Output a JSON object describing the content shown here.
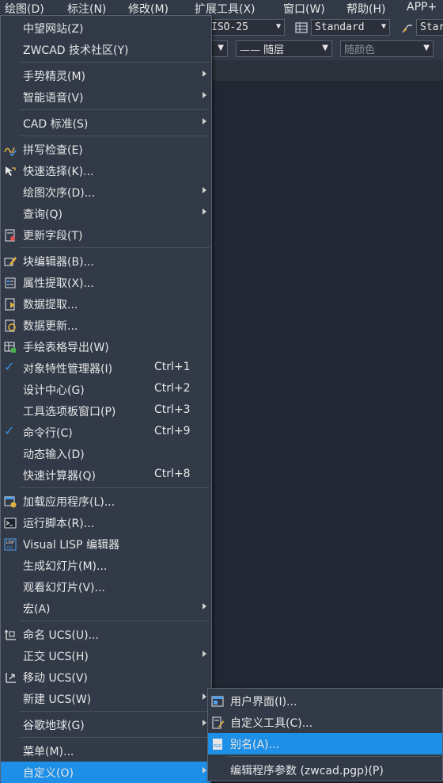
{
  "menubar": {
    "items": [
      "绘图(D)",
      "标注(N)",
      "修改(M)",
      "扩展工具(X)",
      "窗口(W)",
      "帮助(H)",
      "APP+"
    ]
  },
  "toolbar": {
    "dimstyle": "ISO-25",
    "tablestyle": "Standard",
    "mleaderstyle": "Star",
    "linetype": "—— 随层",
    "color": "随颜色"
  },
  "menu": {
    "items": [
      {
        "label": "中望网站(Z)",
        "icon": "",
        "submenu": false
      },
      {
        "label": "ZWCAD 技术社区(Y)",
        "icon": "",
        "submenu": false
      },
      {
        "label": "手势精灵(M)",
        "icon": "",
        "submenu": true
      },
      {
        "label": "智能语音(V)",
        "icon": "",
        "submenu": true
      },
      {
        "label": "CAD 标准(S)",
        "icon": "",
        "submenu": true
      },
      {
        "label": "拼写检查(E)",
        "icon": "spell-check-icon",
        "submenu": false
      },
      {
        "label": "快速选择(K)...",
        "icon": "quick-select-icon",
        "submenu": false
      },
      {
        "label": "绘图次序(D)...",
        "icon": "",
        "submenu": true
      },
      {
        "label": "查询(Q)",
        "icon": "",
        "submenu": true
      },
      {
        "label": "更新字段(T)",
        "icon": "update-field-icon",
        "submenu": false
      },
      {
        "label": "块编辑器(B)...",
        "icon": "block-editor-icon",
        "submenu": false
      },
      {
        "label": "属性提取(X)...",
        "icon": "attribute-extract-icon",
        "submenu": false
      },
      {
        "label": "数据提取...",
        "icon": "data-extract-icon",
        "submenu": false
      },
      {
        "label": "数据更新...",
        "icon": "data-update-icon",
        "submenu": false
      },
      {
        "label": "手绘表格导出(W)",
        "icon": "table-export-icon",
        "submenu": false
      },
      {
        "label": "对象特性管理器(I)",
        "icon": "check-icon",
        "shortcut": "Ctrl+1",
        "submenu": false
      },
      {
        "label": "设计中心(G)",
        "icon": "",
        "shortcut": "Ctrl+2",
        "submenu": false
      },
      {
        "label": "工具选项板窗口(P)",
        "icon": "",
        "shortcut": "Ctrl+3",
        "submenu": false
      },
      {
        "label": "命令行(C)",
        "icon": "check-icon",
        "shortcut": "Ctrl+9",
        "submenu": false
      },
      {
        "label": "动态输入(D)",
        "icon": "",
        "submenu": false
      },
      {
        "label": "快速计算器(Q)",
        "icon": "",
        "shortcut": "Ctrl+8",
        "submenu": false
      },
      {
        "label": "加载应用程序(L)...",
        "icon": "load-app-icon",
        "submenu": false
      },
      {
        "label": "运行脚本(R)...",
        "icon": "run-script-icon",
        "submenu": false
      },
      {
        "label": "Visual LISP 编辑器",
        "icon": "lisp-icon",
        "submenu": false
      },
      {
        "label": "生成幻灯片(M)...",
        "icon": "",
        "submenu": false
      },
      {
        "label": "观看幻灯片(V)...",
        "icon": "",
        "submenu": false
      },
      {
        "label": "宏(A)",
        "icon": "",
        "submenu": true
      },
      {
        "label": "命名 UCS(U)...",
        "icon": "ucs-named-icon",
        "submenu": false
      },
      {
        "label": "正交 UCS(H)",
        "icon": "",
        "submenu": true
      },
      {
        "label": "移动 UCS(V)",
        "icon": "ucs-move-icon",
        "submenu": false
      },
      {
        "label": "新建 UCS(W)",
        "icon": "",
        "submenu": true
      },
      {
        "label": "谷歌地球(G)",
        "icon": "",
        "submenu": true
      },
      {
        "label": "菜单(M)...",
        "icon": "",
        "submenu": false
      },
      {
        "label": "自定义(O)",
        "icon": "",
        "submenu": true,
        "highlighted": true
      }
    ]
  },
  "submenu": {
    "items": [
      {
        "label": "用户界面(I)...",
        "icon": "user-interface-icon"
      },
      {
        "label": "自定义工具(C)...",
        "icon": "custom-tools-icon"
      },
      {
        "label": "别名(A)...",
        "icon": "alias-pgp-icon",
        "highlighted": true
      },
      {
        "label": "编辑程序参数 (zwcad.pgp)(P)",
        "icon": ""
      }
    ]
  }
}
